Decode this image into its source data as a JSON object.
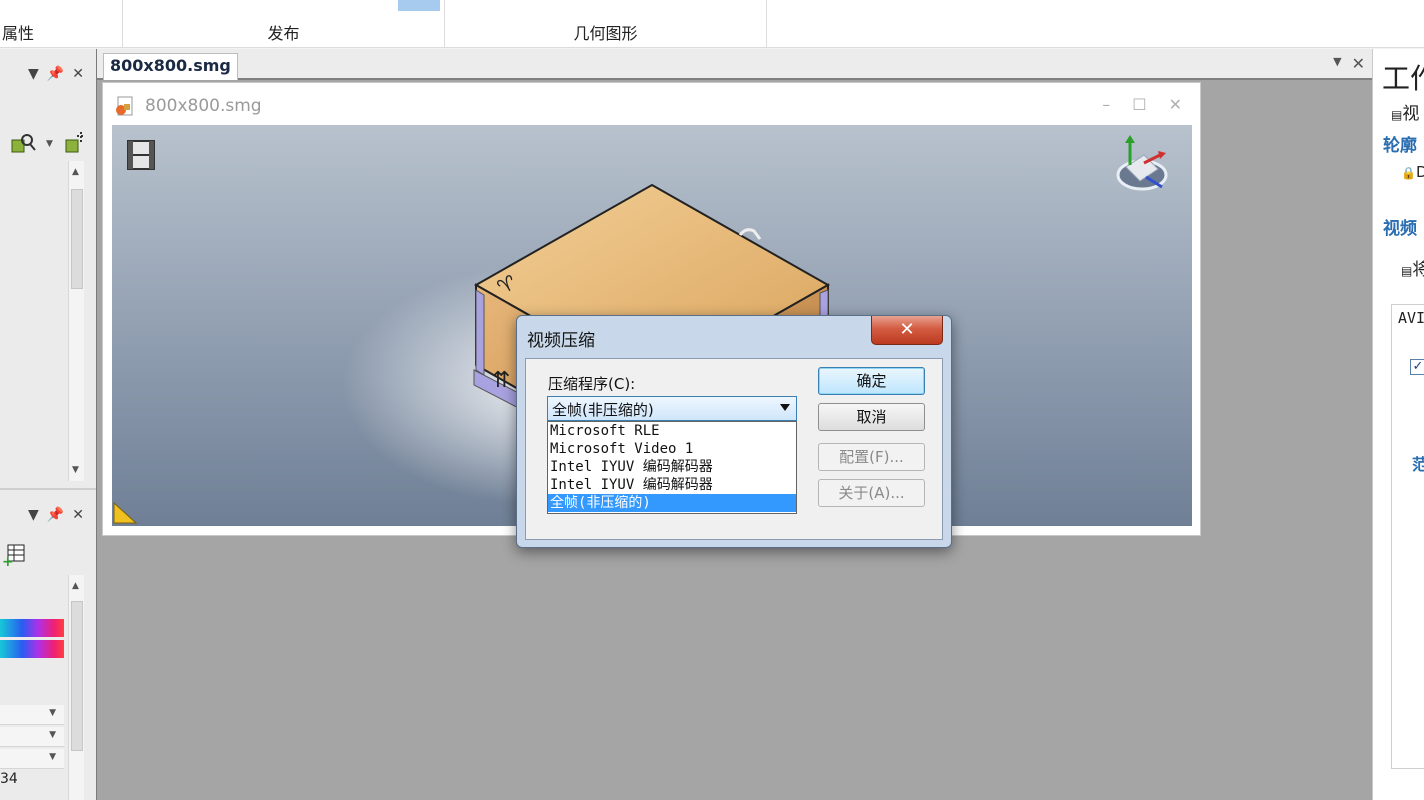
{
  "ribbon": {
    "groups": [
      {
        "label": "属性"
      },
      {
        "label": "发布"
      },
      {
        "label": "几何图形"
      }
    ]
  },
  "left_panel": {
    "bottom_text": "34"
  },
  "document": {
    "tab_label": "800x800.smg",
    "window_title": "800x800.smg"
  },
  "dialog": {
    "title": "视频压缩",
    "compressor_label": "压缩程序(C):",
    "selected": "全帧(非压缩的)",
    "options": [
      "Microsoft RLE",
      "Microsoft Video 1",
      "Intel IYUV 编码解码器",
      "Intel IYUV 编码解码器",
      "全帧(非压缩的)"
    ],
    "ok_label": "确定",
    "cancel_label": "取消",
    "configure_label": "配置(F)...",
    "about_label": "关于(A)..."
  },
  "right_panel": {
    "title": "工作",
    "item_view": "视",
    "head_outline": "轮廓",
    "item_lock": "D",
    "head_video": "视频",
    "item_will": "将",
    "box_text": "AVI",
    "range_text": "范"
  },
  "colors": {
    "accent": "#3399ff",
    "panel_heading": "#2a6db0",
    "close_button": "#c9452a"
  }
}
